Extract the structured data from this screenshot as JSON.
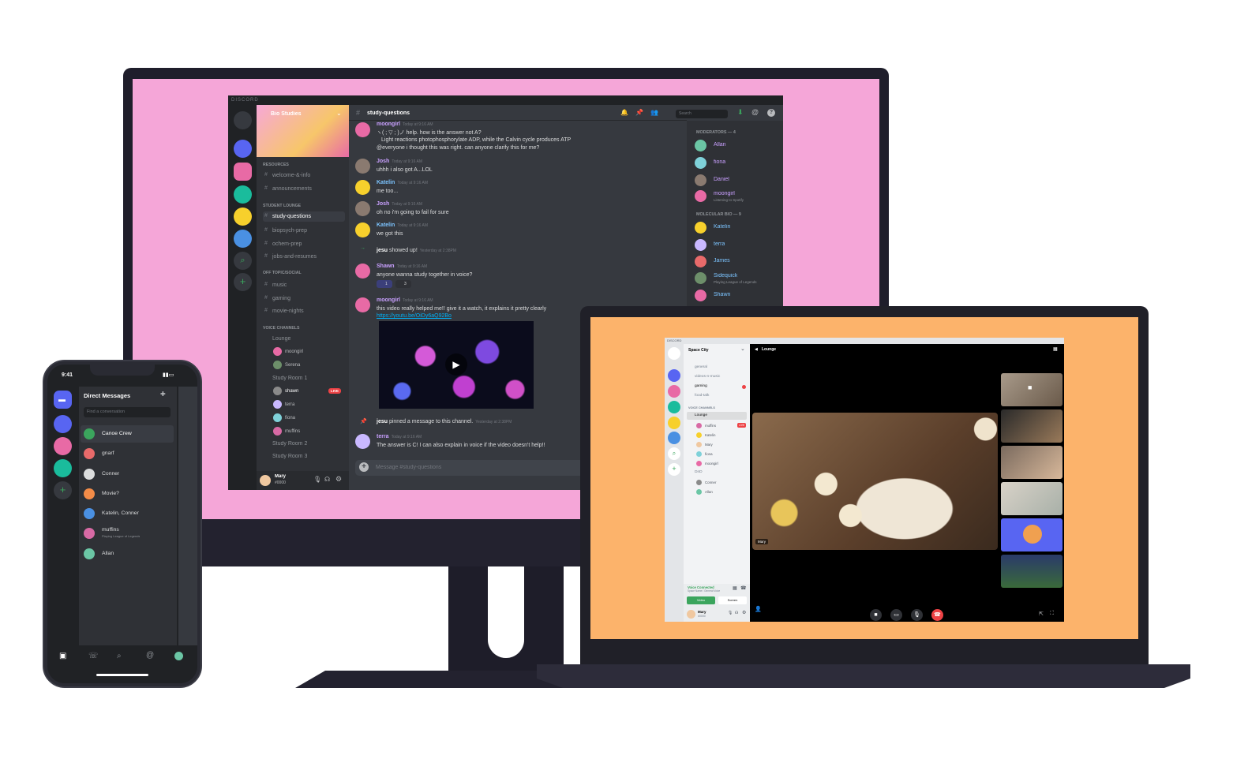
{
  "desktop": {
    "title": "DISCORD",
    "server_name": "Bio Studies",
    "categories": {
      "resources": "RESOURCES",
      "lounge": "STUDENT LOUNGE",
      "offtopic": "OFF TOPIC/SOCIAL",
      "voice": "VOICE CHANNELS"
    },
    "channels": [
      "welcome-&-info",
      "announcements",
      "study-questions",
      "biopsych-prep",
      "ochem-prep",
      "jobs-and-resumes",
      "music",
      "gaming",
      "movie-nights"
    ],
    "voice_channels": [
      "Lounge",
      "Study Room 1",
      "Study Room 2",
      "Study Room 3"
    ],
    "lounge_users": [
      "moongirl",
      "Serena"
    ],
    "study_room_users": [
      "shawn",
      "terra",
      "fiona",
      "muffins"
    ],
    "live_badge": "LIVE",
    "user": {
      "name": "Mary",
      "tag": "#0000"
    },
    "channel_title": "study-questions",
    "search_placeholder": "Search",
    "messages": [
      {
        "name": "moongirl",
        "time": "Today at 9:16 AM",
        "lines": [
          "ヽ( ; ▽ ; )ノ help. how is the answer not A?",
          "Light reactions photophosphorylate ADP, while the Calvin cycle produces ATP",
          "@everyone i thought this was right. can anyone clarify this for me?"
        ]
      },
      {
        "name": "Josh",
        "time": "Today at 9:16 AM",
        "lines": [
          "uhhh i also got A...LOL"
        ]
      },
      {
        "name": "Katelin",
        "time": "Today at 9:16 AM",
        "lines": [
          "me too..."
        ]
      },
      {
        "name": "Josh",
        "time": "Today at 9:16 AM",
        "lines": [
          "oh no i'm going to fail for sure"
        ]
      },
      {
        "name": "Katelin",
        "time": "Today at 9:16 AM",
        "lines": [
          "we got this"
        ]
      },
      {
        "name": "Shawn",
        "time": "Today at 9:16 AM",
        "lines": [
          "anyone wanna study together in voice?"
        ]
      },
      {
        "name": "moongirl",
        "time": "Today at 9:16 AM",
        "lines": [
          "this video really helped me!! give it a watch, it explains it pretty clearly"
        ]
      },
      {
        "name": "terra",
        "time": "Today at 9:16 AM",
        "lines": [
          "The answer is C! I can also explain in voice if the video doesn't help!!"
        ]
      }
    ],
    "system1": {
      "name": "jesu",
      "text": "showed up!",
      "time": "Yesterday at 2:38PM"
    },
    "system2": {
      "name": "jesu",
      "text": "pinned a message to this channel.",
      "time": "Yesterday at 2:38PM"
    },
    "reactions": [
      "1",
      "3"
    ],
    "link": "https://youtu.be/OiDy6aQ92Bo",
    "composer_placeholder": "Message #study-questions",
    "members_headers": [
      "MODERATORS — 4",
      "MOLECULAR BIO — 9"
    ],
    "moderators": [
      {
        "name": "Allan",
        "status": ""
      },
      {
        "name": "fiona",
        "status": ""
      },
      {
        "name": "Daniel",
        "status": ""
      },
      {
        "name": "moongirl",
        "status": "Listening to Spotify"
      }
    ],
    "mol_bio": [
      {
        "name": "Katelin",
        "status": ""
      },
      {
        "name": "terra",
        "status": ""
      },
      {
        "name": "James",
        "status": ""
      },
      {
        "name": "Sidequick",
        "status": "Playing League of Legends"
      },
      {
        "name": "Shawn",
        "status": ""
      }
    ]
  },
  "laptop": {
    "title": "DISCORD",
    "server_name": "Space City",
    "channels": [
      "general",
      "videos-n-music",
      "gaming",
      "food-talk"
    ],
    "voice_header": "VOICE CHANNELS",
    "voice_channels": [
      "Lounge",
      "DnD"
    ],
    "lounge_users": [
      "muffins",
      "Katelin",
      "Mary",
      "fiona",
      "moongirl"
    ],
    "dnd_users": [
      "Conner",
      "Allan"
    ],
    "live_badge": "LIVE",
    "voice_title": "Lounge",
    "voice_connected": "Voice Connected",
    "voice_sub": "Space Name / General Voice",
    "btn_video": "Video",
    "btn_screen": "Screen",
    "user": {
      "name": "Mary",
      "tag": "#0000"
    },
    "main_label": "Mary"
  },
  "phone": {
    "time": "9:41",
    "header": "Direct Messages",
    "search_placeholder": "Find a conversation",
    "dms": [
      {
        "name": "Canoe Crew",
        "status": ""
      },
      {
        "name": "gnarf",
        "status": ""
      },
      {
        "name": "Conner",
        "status": ""
      },
      {
        "name": "Movie?",
        "status": ""
      },
      {
        "name": "Katelin, Conner",
        "status": ""
      },
      {
        "name": "muffins",
        "status": "Playing League of Legends"
      },
      {
        "name": "Allan",
        "status": ""
      }
    ]
  }
}
